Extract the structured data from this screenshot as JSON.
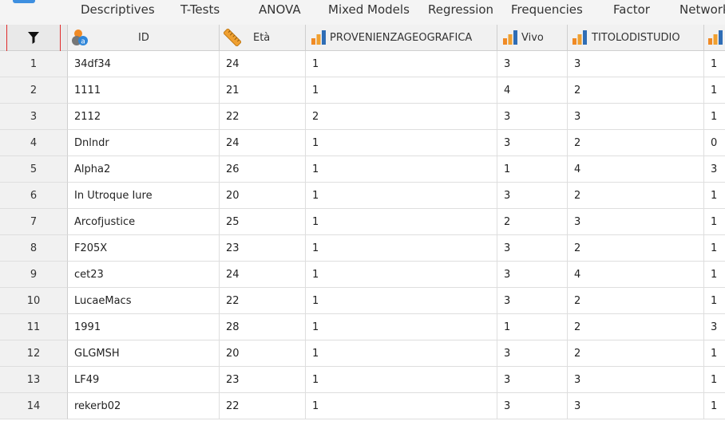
{
  "menu": {
    "items": [
      "Descriptives",
      "T-Tests",
      "ANOVA",
      "Mixed Models",
      "Regression",
      "Frequencies",
      "Factor",
      "Network"
    ]
  },
  "grid": {
    "columns": [
      {
        "label": "ID",
        "icon": "nominal-text-icon"
      },
      {
        "label": "Età",
        "icon": "ruler-icon"
      },
      {
        "label": "PROVENIENZAGEOGRAFICA",
        "icon": "ordinal-bars-icon"
      },
      {
        "label": "Vivo",
        "icon": "ordinal-bars-icon"
      },
      {
        "label": "TITOLODISTUDIO",
        "icon": "ordinal-bars-icon"
      },
      {
        "label": "",
        "icon": "ordinal-bars-icon"
      }
    ],
    "rows": [
      {
        "n": "1",
        "cells": [
          "34df34",
          "24",
          "1",
          "3",
          "3",
          "1"
        ]
      },
      {
        "n": "2",
        "cells": [
          "1111",
          "21",
          "1",
          "4",
          "2",
          "1"
        ]
      },
      {
        "n": "3",
        "cells": [
          "2112",
          "22",
          "2",
          "3",
          "3",
          "1"
        ]
      },
      {
        "n": "4",
        "cells": [
          "Dnlndr",
          "24",
          "1",
          "3",
          "2",
          "0"
        ]
      },
      {
        "n": "5",
        "cells": [
          "Alpha2",
          "26",
          "1",
          "1",
          "4",
          "3"
        ]
      },
      {
        "n": "6",
        "cells": [
          "In Utroque Iure",
          "20",
          "1",
          "3",
          "2",
          "1"
        ]
      },
      {
        "n": "7",
        "cells": [
          "Arcofjustice",
          "25",
          "1",
          "2",
          "3",
          "1"
        ]
      },
      {
        "n": "8",
        "cells": [
          "F205X",
          "23",
          "1",
          "3",
          "2",
          "1"
        ]
      },
      {
        "n": "9",
        "cells": [
          "cet23",
          "24",
          "1",
          "3",
          "4",
          "1"
        ]
      },
      {
        "n": "10",
        "cells": [
          "LucaeMacs",
          "22",
          "1",
          "3",
          "2",
          "1"
        ]
      },
      {
        "n": "11",
        "cells": [
          "1991",
          "28",
          "1",
          "1",
          "2",
          "3"
        ]
      },
      {
        "n": "12",
        "cells": [
          "GLGMSH",
          "20",
          "1",
          "3",
          "2",
          "1"
        ]
      },
      {
        "n": "13",
        "cells": [
          "LF49",
          "23",
          "1",
          "3",
          "3",
          "1"
        ]
      },
      {
        "n": "14",
        "cells": [
          "rekerb02",
          "22",
          "1",
          "3",
          "3",
          "1"
        ]
      }
    ]
  },
  "colors": {
    "accent": "#3e8fe0",
    "highlight": "#e02b2b",
    "nominal_orange": "#f08a24",
    "ordinal_blue": "#2f6db5"
  }
}
